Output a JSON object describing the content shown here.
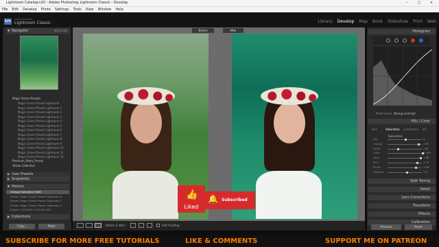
{
  "window": {
    "title": "Lightroom Catalog-v10 - Adobe Photoshop Lightroom Classic - Develop",
    "controls": "– □ ×"
  },
  "menu": [
    "File",
    "Edit",
    "Develop",
    "Photo",
    "Settings",
    "Tools",
    "View",
    "Window",
    "Help"
  ],
  "identity": {
    "badge": "Lrc",
    "line1": "Adobe Photoshop",
    "line2": "Lightroom Classic"
  },
  "modules": [
    "Library",
    "Develop",
    "Map",
    "Book",
    "Slideshow",
    "Print",
    "Web"
  ],
  "left": {
    "navigator": {
      "title": "Navigator",
      "zoom": "FIT  1:1  3:1"
    },
    "presets_group": "Magic Green Presets",
    "presets": [
      "Magic Green Preset Lightroom",
      "Magic Green Preset Lightroom 1",
      "Magic Green Preset Lightroom 2",
      "Magic Green Preset Lightroom 3",
      "Magic Green Preset Lightroom 4",
      "Magic Green Preset Lightroom 5",
      "Magic Green Preset Lightroom 6",
      "Magic Green Preset Lightroom 7",
      "Magic Green Preset Lightroom 8",
      "Magic Green Preset Lightroom 9",
      "Magic Green Preset Lightroom 10",
      "Magic Green Preset Lightroom 11",
      "Magic Green Preset Lightroom 12"
    ],
    "other_groups": [
      "Premium_Retro_Preset",
      "Yellow Collection"
    ],
    "user_presets": "User Presets",
    "snapshots": "Snapshots",
    "history": {
      "title": "History",
      "items": [
        "Orange Saturation Shift",
        "Preset: Magic Green Preset Lightroom 6",
        "Preset: Magic Green Preset Lightroom 7",
        "Preset: Magic Green Preset Lightroom 4",
        "Import (7/21/2021 8:34:29 AM)"
      ]
    },
    "collections": "Collections",
    "copy": "Copy...",
    "paste": "Paste"
  },
  "center": {
    "before": "Before",
    "after": "After",
    "view_label": "Before & After :",
    "soft_proof": "Soft Proofing"
  },
  "overlay": {
    "liked": "Liked",
    "subscribed": "Subscribed"
  },
  "right": {
    "histogram": "Histogram",
    "tone_tabs": [
      "Point Curve",
      "Strong Contrast"
    ],
    "hsl_title": "HSL / Color",
    "hsl_tabs": [
      "Hue",
      "Saturation",
      "Luminance",
      "All"
    ],
    "hsl_group": "Saturation",
    "sliders": [
      {
        "label": "Red",
        "value": "0"
      },
      {
        "label": "Orange",
        "value": "+ 87"
      },
      {
        "label": "Yellow",
        "value": "- 40"
      },
      {
        "label": "Green",
        "value": "+ 100"
      },
      {
        "label": "Aqua",
        "value": "+ 90"
      },
      {
        "label": "Blue",
        "value": "+ 71"
      },
      {
        "label": "Purple",
        "value": "+ 58"
      },
      {
        "label": "Magenta",
        "value": "+ 5"
      }
    ],
    "panels": [
      "Split Toning",
      "Detail",
      "Lens Corrections",
      "Transform",
      "Effects",
      "Calibration"
    ],
    "previous": "Previous",
    "reset": "Reset"
  },
  "banner": {
    "left": "SUBSCRIBE FOR MORE FREE TUTORIALS",
    "mid": "LIKE & COMMENTS",
    "right": "SUPPORT ME ON PATREON"
  },
  "colors": {
    "accent": "#ff7b00",
    "panel": "#2a2a2a",
    "red": "#d62b2b"
  }
}
